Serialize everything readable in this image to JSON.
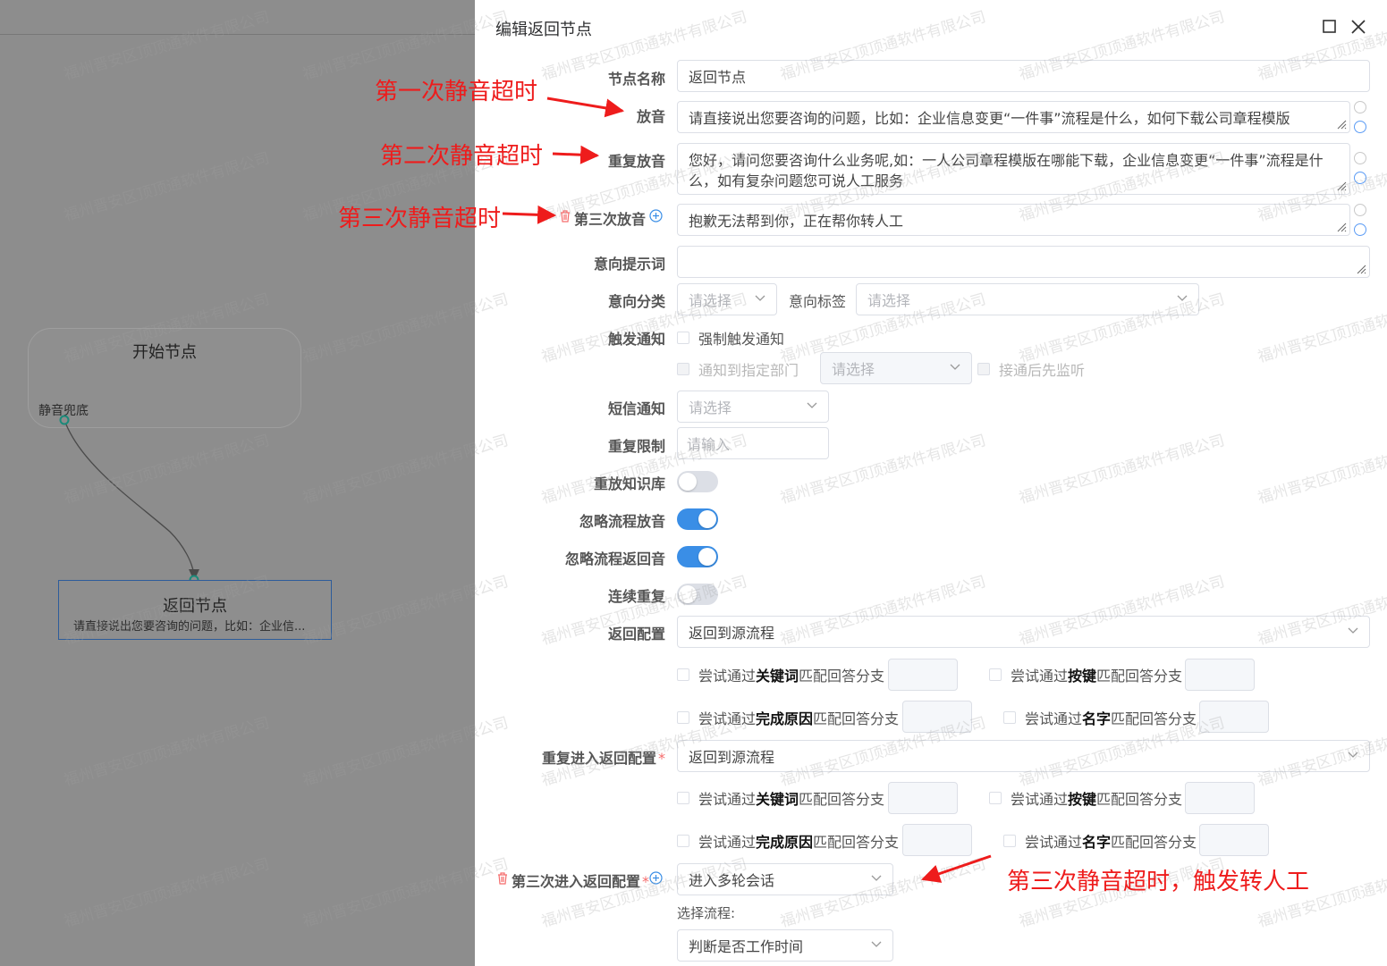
{
  "canvas": {
    "start_node": {
      "title": "开始节点",
      "port_label": "静音兜底"
    },
    "return_node": {
      "title": "返回节点",
      "subtitle": "请直接说出您要咨询的问题，比如：企业信..."
    }
  },
  "dialog": {
    "title": "编辑返回节点",
    "node_name": {
      "label": "节点名称",
      "value": "返回节点"
    },
    "play": {
      "label": "放音",
      "value": "请直接说出您要咨询的问题，比如：企业信息变更“一件事”流程是什么，如何下载公司章程模版"
    },
    "replay": {
      "label": "重复放音",
      "value": "您好，请问您要咨询什么业务呢,如：一人公司章程模版在哪能下载，企业信息变更“一件事”流程是什么，如有复杂问题您可说人工服务"
    },
    "third_play": {
      "label": "第三次放音",
      "value": "抱歉无法帮到你，正在帮你转人工"
    },
    "intent_prompt": {
      "label": "意向提示词",
      "value": ""
    },
    "intent_category": {
      "label": "意向分类",
      "placeholder": "请选择"
    },
    "intent_tag": {
      "label": "意向标签",
      "placeholder": "请选择"
    },
    "trigger_notify": {
      "label": "触发通知",
      "force": "强制触发通知",
      "dept": "通知到指定部门",
      "dept_placeholder": "请选择",
      "monitor": "接通后先监听"
    },
    "sms_notify": {
      "label": "短信通知",
      "placeholder": "请选择"
    },
    "repeat_limit": {
      "label": "重复限制",
      "placeholder": "请输入"
    },
    "switches": {
      "replay_kb": {
        "label": "重放知识库",
        "on": false
      },
      "ignore_flow_play": {
        "label": "忽略流程放音",
        "on": true
      },
      "ignore_flow_return": {
        "label": "忽略流程返回音",
        "on": true
      },
      "continuous_repeat": {
        "label": "连续重复",
        "on": false
      }
    },
    "return_config": {
      "label": "返回配置",
      "value": "返回到源流程"
    },
    "repeat_return_config": {
      "label": "重复进入返回配置",
      "value": "返回到源流程"
    },
    "third_return_config": {
      "label": "第三次进入返回配置",
      "value": "进入多轮会话"
    },
    "choose_flow": {
      "label": "选择流程:",
      "value": "判断是否工作时间"
    },
    "match": {
      "keyword": {
        "pre": "尝试通过",
        "bold": "关键词",
        "post": "匹配回答分支"
      },
      "key": {
        "pre": "尝试通过",
        "bold": "按键",
        "post": "匹配回答分支"
      },
      "reason": {
        "pre": "尝试通过",
        "bold": "完成原因",
        "post": "匹配回答分支"
      },
      "name": {
        "pre": "尝试通过",
        "bold": "名字",
        "post": "匹配回答分支"
      }
    }
  },
  "annotations": {
    "first": "第一次静音超时",
    "second": "第二次静音超时",
    "third": "第三次静音超时",
    "third_transfer": "第三次静音超时，触发转人工"
  },
  "watermark": "福州晋安区顶顶通软件有限公司",
  "colors": {
    "primary": "#3a8ee6",
    "annotation": "#ee1c1c",
    "danger": "#f56c6c"
  }
}
